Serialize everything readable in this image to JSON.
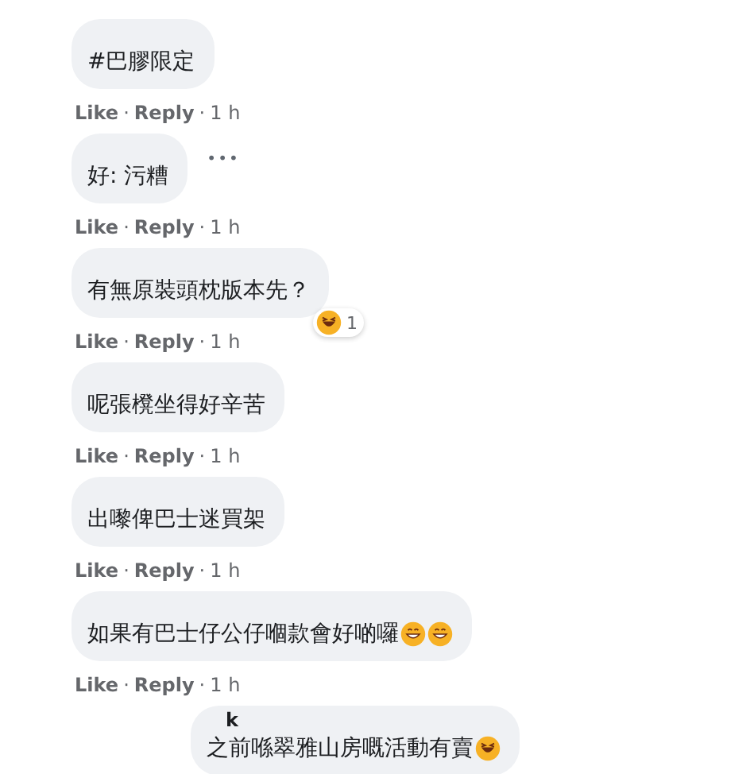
{
  "comments": [
    {
      "text": "#巴膠限定",
      "reply": false,
      "meta": [
        {
          "kind": "link",
          "text": "Like"
        },
        {
          "kind": "dot",
          "text": "·"
        },
        {
          "kind": "link",
          "text": "Reply"
        },
        {
          "kind": "dot",
          "text": "·"
        },
        {
          "kind": "time",
          "text": "1 h"
        }
      ]
    },
    {
      "text": "好: 污糟",
      "menu": "•••",
      "reply": false,
      "meta": [
        {
          "kind": "link",
          "text": "Like"
        },
        {
          "kind": "dot",
          "text": "·"
        },
        {
          "kind": "link",
          "text": "Reply"
        },
        {
          "kind": "dot",
          "text": "·"
        },
        {
          "kind": "time",
          "text": "1 h"
        }
      ]
    },
    {
      "text": "有無原裝頭枕版本先？",
      "reaction": {
        "kind": "laugh",
        "count": "1"
      },
      "reply": false,
      "meta": [
        {
          "kind": "link",
          "text": "Like"
        },
        {
          "kind": "dot",
          "text": "·"
        },
        {
          "kind": "link",
          "text": "Reply"
        },
        {
          "kind": "dot",
          "text": "·"
        },
        {
          "kind": "time",
          "text": "1 h"
        }
      ]
    },
    {
      "text": "呢張櫈坐得好辛苦",
      "reply": false,
      "meta": [
        {
          "kind": "link",
          "text": "Like"
        },
        {
          "kind": "dot",
          "text": "·"
        },
        {
          "kind": "link",
          "text": "Reply"
        },
        {
          "kind": "dot",
          "text": "·"
        },
        {
          "kind": "time",
          "text": "1 h"
        }
      ]
    },
    {
      "text": "出嚟俾巴士迷買架",
      "reply": false,
      "meta": [
        {
          "kind": "link",
          "text": "Like"
        },
        {
          "kind": "dot",
          "text": "·"
        },
        {
          "kind": "link",
          "text": "Reply"
        },
        {
          "kind": "dot",
          "text": "·"
        },
        {
          "kind": "time",
          "text": "1 h"
        }
      ]
    },
    {
      "text": "如果有巴士仔公仔嗰款會好啲囉",
      "emojis": [
        {
          "kind": "grin"
        },
        {
          "kind": "grin"
        }
      ],
      "reply": false,
      "meta": [
        {
          "kind": "link",
          "text": "Like"
        },
        {
          "kind": "dot",
          "text": "·"
        },
        {
          "kind": "link",
          "text": "Reply"
        },
        {
          "kind": "dot",
          "text": "·"
        },
        {
          "kind": "time",
          "text": "1 h"
        }
      ]
    },
    {
      "author": "k",
      "text": "之前喺翠雅山房嘅活動有賣",
      "emojis": [
        {
          "kind": "laugh"
        }
      ],
      "reply": true
    }
  ]
}
